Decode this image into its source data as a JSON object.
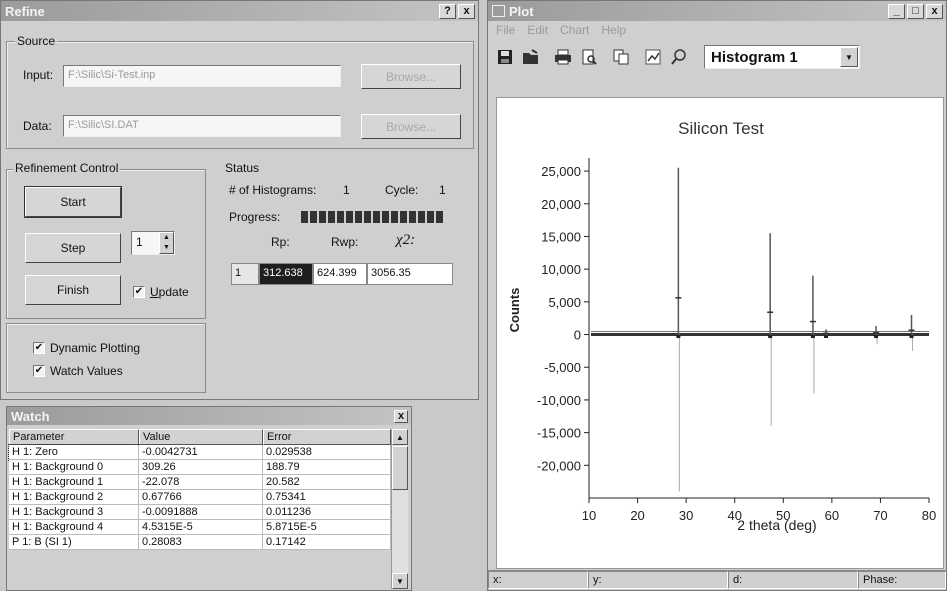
{
  "refine": {
    "title": "Refine",
    "help_glyph": "?",
    "close_glyph": "x",
    "source_label": "Source",
    "input_label": "Input:",
    "input_value": "F:\\Silic\\Si-Test.inp",
    "data_label": "Data:",
    "data_value": "F:\\Silic\\SI.DAT",
    "browse_label": "Browse...",
    "refinement_label": "Refinement Control",
    "start_label": "Start",
    "step_label": "Step",
    "step_value": "1",
    "finish_label": "Finish",
    "update_label": "Update",
    "update_checked": true,
    "dynamic_plotting_label": "Dynamic Plotting",
    "dynamic_plotting_checked": true,
    "watch_values_label": "Watch Values",
    "watch_values_checked": true,
    "check_glyph": "✔",
    "status": {
      "label": "Status",
      "histograms_label": "# of Histograms:",
      "histograms_value": "1",
      "cycle_label": "Cycle:",
      "cycle_value": "1",
      "progress_label": "Progress:",
      "progress": 1.0,
      "rp_label": "Rp:",
      "rwp_label": "Rwp:",
      "chi2_label": "χ2:",
      "row_index": "1",
      "rp_value": "312.638",
      "rwp_value": "624.399",
      "chi2_value": "3056.35"
    }
  },
  "watch": {
    "title": "Watch",
    "close_glyph": "x",
    "columns": [
      "Parameter",
      "Value",
      "Error"
    ],
    "rows": [
      [
        "H 1: Zero",
        "-0.0042731",
        "0.029538"
      ],
      [
        "H 1: Background 0",
        "309.26",
        "188.79"
      ],
      [
        "H 1: Background 1",
        "-22.078",
        "20.582"
      ],
      [
        "H 1: Background 2",
        "0.67766",
        "0.75341"
      ],
      [
        "H 1: Background 3",
        "-0.0091888",
        "0.011236"
      ],
      [
        "H 1: Background 4",
        "4.5315E-5",
        "5.8715E-5"
      ],
      [
        "P 1: B (SI 1)",
        "0.28083",
        "0.17142"
      ]
    ]
  },
  "plot": {
    "title": "Plot",
    "menu": [
      "File",
      "Edit",
      "Chart",
      "Help"
    ],
    "histogram_select": "Histogram 1",
    "min_glyph": "_",
    "max_glyph": "□",
    "close_glyph": "x",
    "status_x": "x:",
    "status_y": "y:",
    "status_d": "d:",
    "status_phase": "Phase:",
    "toolbar_icons": [
      "save-icon",
      "open-icon",
      "print-icon",
      "print-preview-icon",
      "copy-icon",
      "chart-edit-icon",
      "zoom-icon"
    ]
  },
  "chart_data": {
    "type": "line",
    "title": "Silicon Test",
    "xlabel": "2 theta (deg)",
    "ylabel": "Counts",
    "xlim": [
      10,
      80
    ],
    "ylim": [
      -25000,
      27000
    ],
    "xticks": [
      10,
      20,
      30,
      40,
      50,
      60,
      70,
      80
    ],
    "yticks": [
      25000,
      20000,
      15000,
      10000,
      5000,
      0,
      -5000,
      -10000,
      -15000,
      -20000
    ],
    "ytick_labels": [
      "25,000",
      "20,000",
      "15,000",
      "10,000",
      "5,000",
      "0",
      "-5,000",
      "-10,000",
      "-15,000",
      "-20,000"
    ],
    "xtick_labels": [
      "10",
      "20",
      "30",
      "40",
      "50",
      "60",
      "70",
      "80"
    ],
    "grid": false,
    "peaks": [
      {
        "x": 28.4,
        "y": 25500,
        "diff_min": -24000
      },
      {
        "x": 47.3,
        "y": 15500,
        "diff_min": -14000
      },
      {
        "x": 56.1,
        "y": 9000,
        "diff_min": -9000
      },
      {
        "x": 58.8,
        "y": 800,
        "diff_min": -500
      },
      {
        "x": 69.1,
        "y": 1300,
        "diff_min": -1500
      },
      {
        "x": 76.4,
        "y": 3000,
        "diff_min": -2500
      }
    ],
    "baseline": 0
  }
}
